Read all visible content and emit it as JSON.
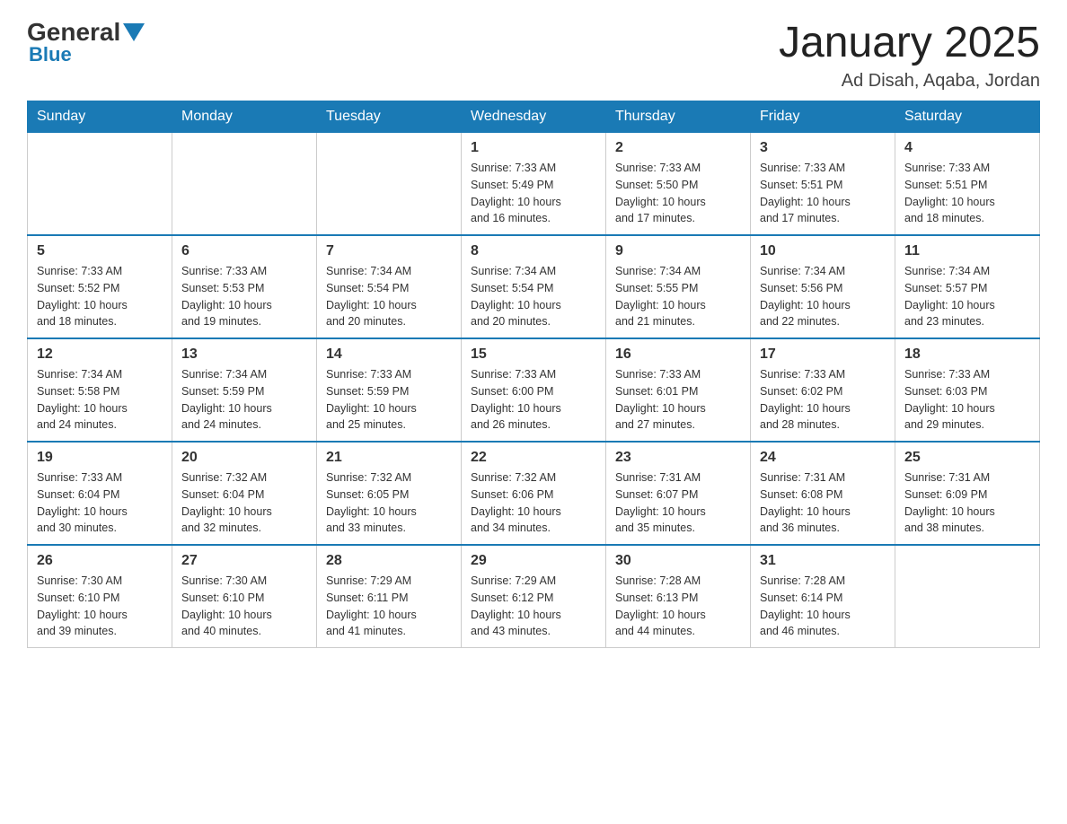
{
  "header": {
    "logo_general": "General",
    "logo_blue": "Blue",
    "month_title": "January 2025",
    "location": "Ad Disah, Aqaba, Jordan"
  },
  "days_of_week": [
    "Sunday",
    "Monday",
    "Tuesday",
    "Wednesday",
    "Thursday",
    "Friday",
    "Saturday"
  ],
  "weeks": [
    [
      {
        "num": "",
        "info": ""
      },
      {
        "num": "",
        "info": ""
      },
      {
        "num": "",
        "info": ""
      },
      {
        "num": "1",
        "info": "Sunrise: 7:33 AM\nSunset: 5:49 PM\nDaylight: 10 hours\nand 16 minutes."
      },
      {
        "num": "2",
        "info": "Sunrise: 7:33 AM\nSunset: 5:50 PM\nDaylight: 10 hours\nand 17 minutes."
      },
      {
        "num": "3",
        "info": "Sunrise: 7:33 AM\nSunset: 5:51 PM\nDaylight: 10 hours\nand 17 minutes."
      },
      {
        "num": "4",
        "info": "Sunrise: 7:33 AM\nSunset: 5:51 PM\nDaylight: 10 hours\nand 18 minutes."
      }
    ],
    [
      {
        "num": "5",
        "info": "Sunrise: 7:33 AM\nSunset: 5:52 PM\nDaylight: 10 hours\nand 18 minutes."
      },
      {
        "num": "6",
        "info": "Sunrise: 7:33 AM\nSunset: 5:53 PM\nDaylight: 10 hours\nand 19 minutes."
      },
      {
        "num": "7",
        "info": "Sunrise: 7:34 AM\nSunset: 5:54 PM\nDaylight: 10 hours\nand 20 minutes."
      },
      {
        "num": "8",
        "info": "Sunrise: 7:34 AM\nSunset: 5:54 PM\nDaylight: 10 hours\nand 20 minutes."
      },
      {
        "num": "9",
        "info": "Sunrise: 7:34 AM\nSunset: 5:55 PM\nDaylight: 10 hours\nand 21 minutes."
      },
      {
        "num": "10",
        "info": "Sunrise: 7:34 AM\nSunset: 5:56 PM\nDaylight: 10 hours\nand 22 minutes."
      },
      {
        "num": "11",
        "info": "Sunrise: 7:34 AM\nSunset: 5:57 PM\nDaylight: 10 hours\nand 23 minutes."
      }
    ],
    [
      {
        "num": "12",
        "info": "Sunrise: 7:34 AM\nSunset: 5:58 PM\nDaylight: 10 hours\nand 24 minutes."
      },
      {
        "num": "13",
        "info": "Sunrise: 7:34 AM\nSunset: 5:59 PM\nDaylight: 10 hours\nand 24 minutes."
      },
      {
        "num": "14",
        "info": "Sunrise: 7:33 AM\nSunset: 5:59 PM\nDaylight: 10 hours\nand 25 minutes."
      },
      {
        "num": "15",
        "info": "Sunrise: 7:33 AM\nSunset: 6:00 PM\nDaylight: 10 hours\nand 26 minutes."
      },
      {
        "num": "16",
        "info": "Sunrise: 7:33 AM\nSunset: 6:01 PM\nDaylight: 10 hours\nand 27 minutes."
      },
      {
        "num": "17",
        "info": "Sunrise: 7:33 AM\nSunset: 6:02 PM\nDaylight: 10 hours\nand 28 minutes."
      },
      {
        "num": "18",
        "info": "Sunrise: 7:33 AM\nSunset: 6:03 PM\nDaylight: 10 hours\nand 29 minutes."
      }
    ],
    [
      {
        "num": "19",
        "info": "Sunrise: 7:33 AM\nSunset: 6:04 PM\nDaylight: 10 hours\nand 30 minutes."
      },
      {
        "num": "20",
        "info": "Sunrise: 7:32 AM\nSunset: 6:04 PM\nDaylight: 10 hours\nand 32 minutes."
      },
      {
        "num": "21",
        "info": "Sunrise: 7:32 AM\nSunset: 6:05 PM\nDaylight: 10 hours\nand 33 minutes."
      },
      {
        "num": "22",
        "info": "Sunrise: 7:32 AM\nSunset: 6:06 PM\nDaylight: 10 hours\nand 34 minutes."
      },
      {
        "num": "23",
        "info": "Sunrise: 7:31 AM\nSunset: 6:07 PM\nDaylight: 10 hours\nand 35 minutes."
      },
      {
        "num": "24",
        "info": "Sunrise: 7:31 AM\nSunset: 6:08 PM\nDaylight: 10 hours\nand 36 minutes."
      },
      {
        "num": "25",
        "info": "Sunrise: 7:31 AM\nSunset: 6:09 PM\nDaylight: 10 hours\nand 38 minutes."
      }
    ],
    [
      {
        "num": "26",
        "info": "Sunrise: 7:30 AM\nSunset: 6:10 PM\nDaylight: 10 hours\nand 39 minutes."
      },
      {
        "num": "27",
        "info": "Sunrise: 7:30 AM\nSunset: 6:10 PM\nDaylight: 10 hours\nand 40 minutes."
      },
      {
        "num": "28",
        "info": "Sunrise: 7:29 AM\nSunset: 6:11 PM\nDaylight: 10 hours\nand 41 minutes."
      },
      {
        "num": "29",
        "info": "Sunrise: 7:29 AM\nSunset: 6:12 PM\nDaylight: 10 hours\nand 43 minutes."
      },
      {
        "num": "30",
        "info": "Sunrise: 7:28 AM\nSunset: 6:13 PM\nDaylight: 10 hours\nand 44 minutes."
      },
      {
        "num": "31",
        "info": "Sunrise: 7:28 AM\nSunset: 6:14 PM\nDaylight: 10 hours\nand 46 minutes."
      },
      {
        "num": "",
        "info": ""
      }
    ]
  ]
}
